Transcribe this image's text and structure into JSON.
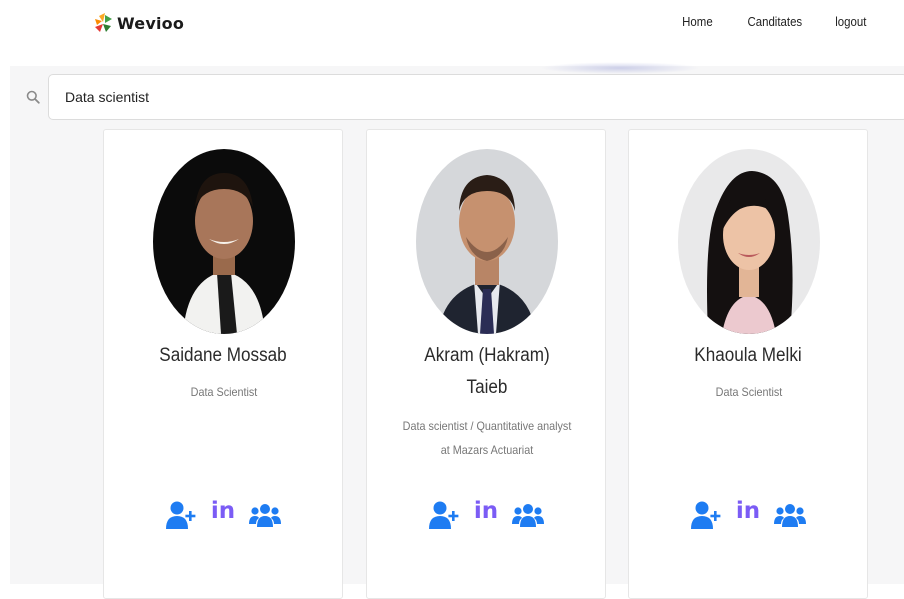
{
  "brand": {
    "name": "Wevioo"
  },
  "nav": {
    "items": [
      "Home",
      "Canditates",
      "logout"
    ]
  },
  "search": {
    "value": "Data scientist",
    "icon": "search-icon"
  },
  "colors": {
    "accent": "#1e7cf2",
    "linkedin": "#7b5cf5"
  },
  "candidates": [
    {
      "name": "Saidane Mossab",
      "title": "Data Scientist"
    },
    {
      "name": "Akram (Hakram) Taieb",
      "title": "Data scientist / Quantitative analyst at Mazars Actuariat"
    },
    {
      "name": "Khaoula Melki",
      "title": "Data Scientist"
    }
  ],
  "actions": {
    "linkedin_label": "in"
  }
}
